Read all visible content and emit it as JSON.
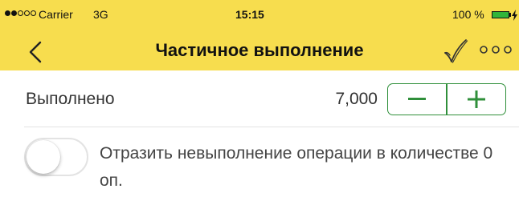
{
  "status_bar": {
    "carrier": "Carrier",
    "network": "3G",
    "time": "15:15",
    "battery_percent_label": "100 %",
    "battery_level": 1.0,
    "signal_bars_filled": 2,
    "signal_bars_total": 5
  },
  "nav": {
    "title": "Частичное выполнение",
    "back_icon": "chevron-left-icon",
    "confirm_icon": "checkmark-icon",
    "more_icon": "more-dots-icon"
  },
  "completed": {
    "label": "Выполнено",
    "value": "7,000",
    "decrement_label": "−",
    "increment_label": "+"
  },
  "non_completion_toggle": {
    "label": "Отразить невыполнение операции в количестве 0 оп.",
    "on": false
  },
  "colors": {
    "bar_background": "#f7dd4e",
    "accent_green": "#2f8f3a",
    "battery_green": "#31b53a"
  }
}
